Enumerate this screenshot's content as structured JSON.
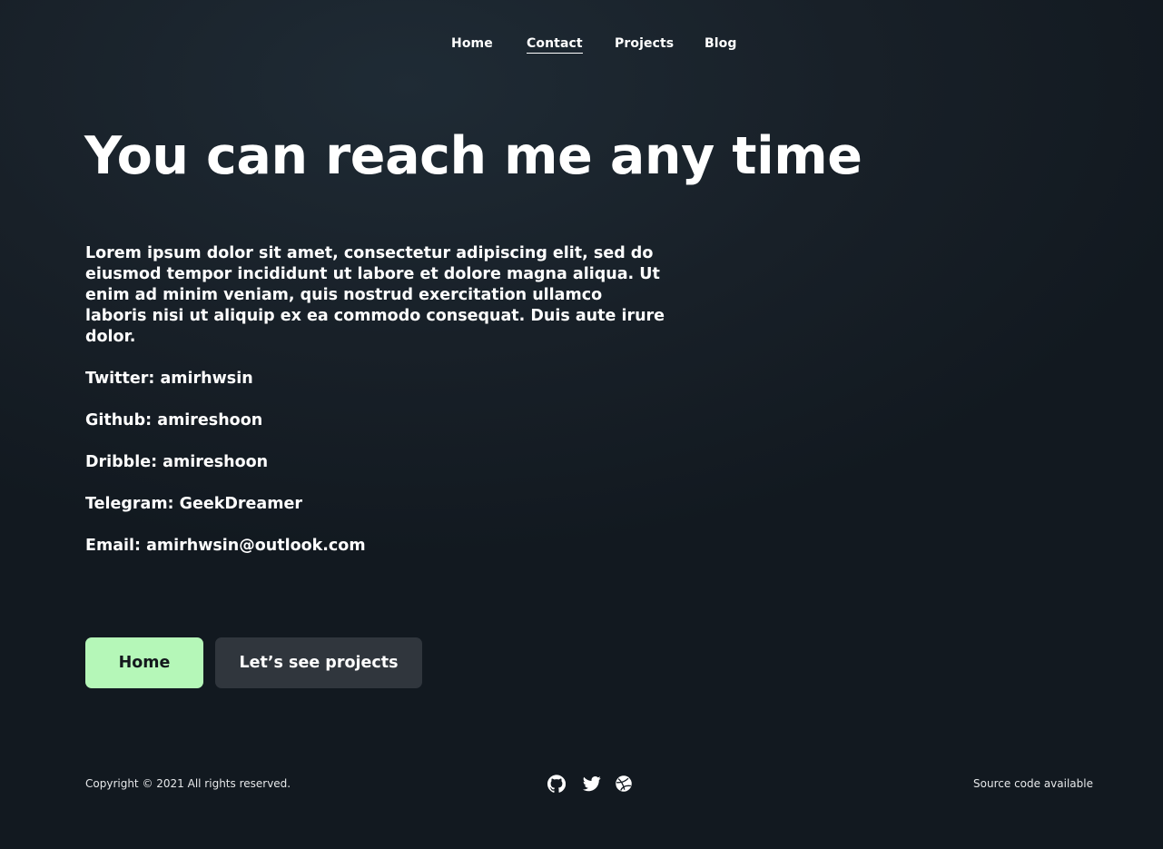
{
  "nav": {
    "items": [
      {
        "label": "Home"
      },
      {
        "label": "Contact",
        "active": true
      },
      {
        "label": "Projects"
      },
      {
        "label": "Blog"
      }
    ]
  },
  "hero": {
    "title": "You can reach me any time"
  },
  "intro": {
    "text": "Lorem ipsum dolor sit amet, consectetur adipiscing elit, sed do eiusmod tempor incididunt ut labore et dolore magna aliqua. Ut enim ad minim veniam, quis nostrud exercitation ullamco laboris nisi ut aliquip ex ea commodo consequat. Duis aute irure dolor."
  },
  "contacts": [
    {
      "text": "Twitter: amirhwsin"
    },
    {
      "text": "Github: amireshoon"
    },
    {
      "text": "Dribble: amireshoon"
    },
    {
      "text": "Telegram: GeekDreamer"
    },
    {
      "text": "Email: amirhwsin@outlook.com"
    }
  ],
  "buttons": {
    "primary": "Home",
    "secondary": "Let’s see projects"
  },
  "footer": {
    "copyright": "Copyright © 2021 All rights reserved.",
    "source": "Source code available",
    "social_icons": [
      "github-icon",
      "twitter-icon",
      "dribbble-icon"
    ]
  },
  "colors": {
    "background": "#182028",
    "primary_button": "#b5f7b8",
    "secondary_button": "#30363d",
    "text": "#ffffff"
  }
}
